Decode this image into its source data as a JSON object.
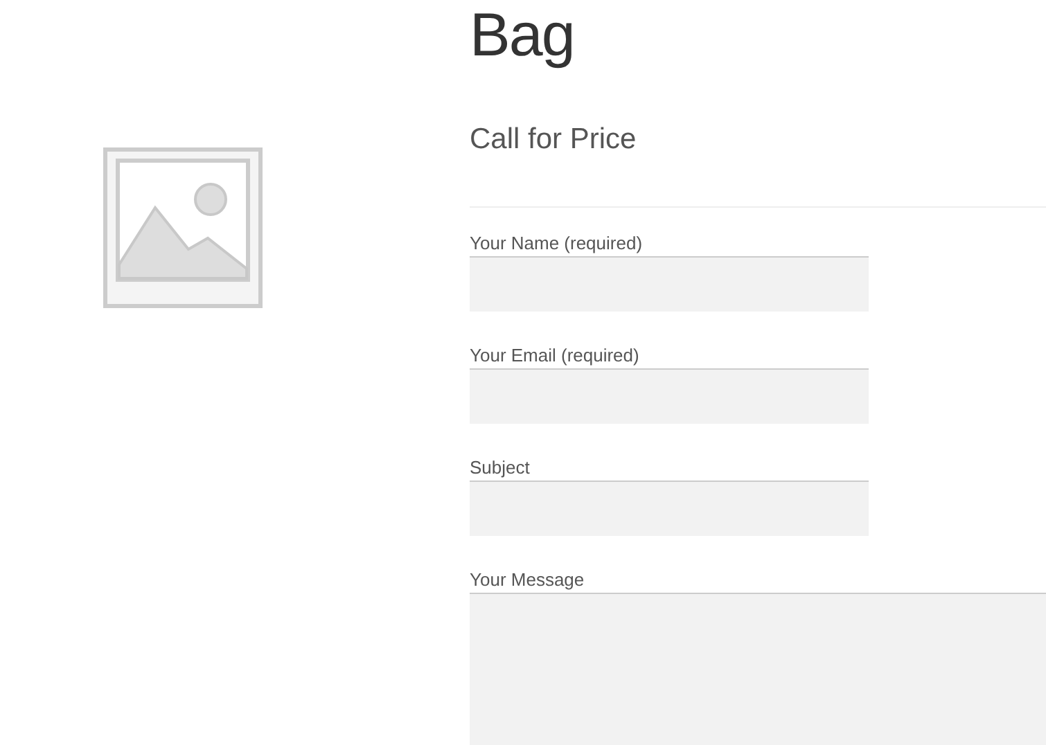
{
  "product": {
    "title": "Bag",
    "image": {
      "kind": "placeholder"
    }
  },
  "form": {
    "heading": "Call for Price",
    "fields": [
      {
        "label": "Your Name (required)",
        "kind": "input"
      },
      {
        "label": "Your Email (required)",
        "kind": "input"
      },
      {
        "label": "Subject",
        "kind": "input"
      },
      {
        "label": "Your Message",
        "kind": "textarea"
      }
    ]
  }
}
